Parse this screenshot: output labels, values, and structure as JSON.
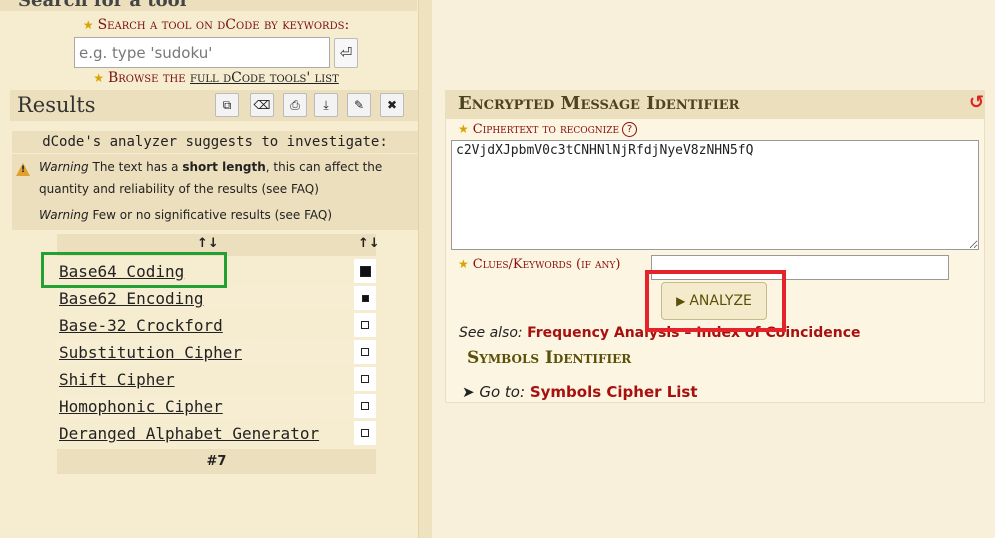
{
  "search": {
    "header": "Search for a tool",
    "label": "Search a tool on dCode by keywords:",
    "placeholder": "e.g. type 'sudoku'",
    "go_icon": "return-icon",
    "browse_prefix": "Browse the ",
    "browse_link": "full dCode tools' list"
  },
  "results": {
    "title": "Results",
    "toolbar": [
      {
        "name": "copy-icon",
        "glyph": "⧉"
      },
      {
        "name": "erase-icon",
        "glyph": "⌫"
      },
      {
        "name": "print-icon",
        "glyph": "⎙"
      },
      {
        "name": "download-icon",
        "glyph": "⤓"
      },
      {
        "name": "pin-icon",
        "glyph": "📌"
      },
      {
        "name": "close-icon",
        "glyph": "✖"
      }
    ],
    "analyzer_text": "dCode's analyzer suggests to investigate:",
    "warning1_label": "Warning",
    "warning1_text_a": " The text has a ",
    "warning1_text_b": "short length",
    "warning1_text_c": ", this can affect the quantity and reliability of the results (see FAQ)",
    "warning2_label": "Warning",
    "warning2_text": " Few or no significative results (see FAQ)",
    "sort_icon": "↑↓",
    "rows": [
      {
        "name": "Base64 Coding",
        "score": 1.0
      },
      {
        "name": "Base62 Encoding",
        "score": 0.55
      },
      {
        "name": "Base-32 Crockford",
        "score": 0.2
      },
      {
        "name": "Substitution Cipher",
        "score": 0.2
      },
      {
        "name": "Shift Cipher",
        "score": 0.2
      },
      {
        "name": "Homophonic Cipher",
        "score": 0.2
      },
      {
        "name": "Deranged Alphabet Generator",
        "score": 0.2
      }
    ],
    "page": "#7"
  },
  "identifier": {
    "title": "Encrypted Message Identifier",
    "reset_glyph": "↺",
    "ciphertext_label": "Ciphertext to recognize",
    "help_glyph": "?",
    "ciphertext_value": "c2VjdXJpbmV0c3tCNHNlNjRfdjNyeV8zNHN5fQ",
    "clues_label": "Clues/Keywords (if any)",
    "clues_value": "",
    "analyze_label": "ANALYZE",
    "see_also_label": "See also:",
    "see_also_link1": "Frequency Analysis",
    "see_also_sep": " – ",
    "see_also_link2": "Index of Coincidence",
    "symbols_title": "Symbols Identifier",
    "goto_arrow": "➤",
    "goto_label": "Go to:",
    "goto_link": "Symbols Cipher List"
  },
  "colors": {
    "accent_red": "#a81010",
    "olive": "#5a5008",
    "highlight_green": "#22a033",
    "highlight_red": "#e4232b"
  }
}
